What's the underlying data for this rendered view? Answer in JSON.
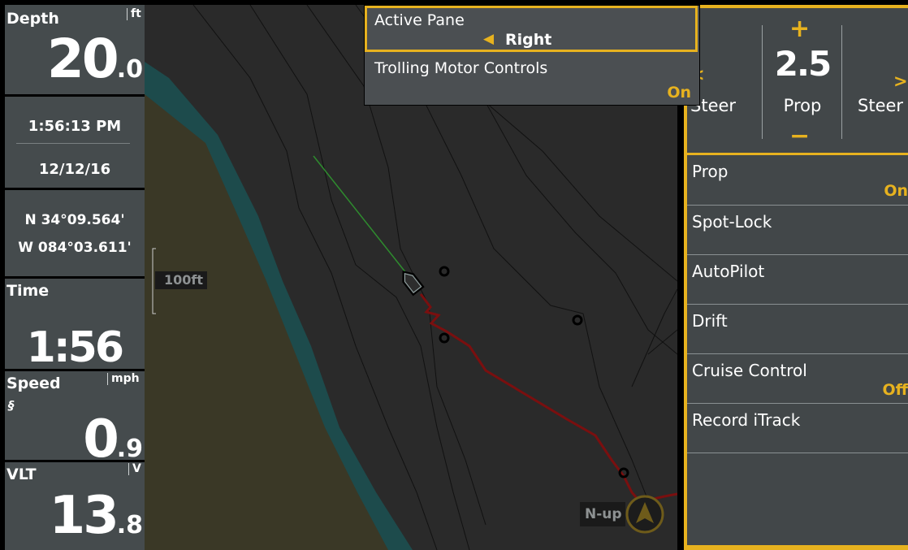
{
  "colors": {
    "accent": "#e7b21f",
    "panel": "#454b4d",
    "track": "#7a0f0f",
    "land": "#3b3a27",
    "shore": "#1b4a4a"
  },
  "databar": {
    "depth": {
      "label": "Depth",
      "unit": "ft",
      "value_int": "20",
      "value_dec": ".0"
    },
    "clock": "1:56:13 PM",
    "date": "12/12/16",
    "lat": "N 34°09.564'",
    "lon": "W 084°03.611'",
    "time": {
      "label": "Time",
      "value": "1:56"
    },
    "speed": {
      "label": "Speed",
      "unit": "mph",
      "value_int": "0",
      "value_dec": ".9"
    },
    "vlt": {
      "label": "VLT",
      "unit": "V",
      "value_int": "13",
      "value_dec": ".8"
    }
  },
  "map": {
    "range_label": "100ft",
    "orientation_label": "N-up",
    "icons": [
      "boat-icon",
      "waypoint-icon",
      "north-arrow-icon"
    ]
  },
  "popup": {
    "active_pane_label": "Active Pane",
    "active_pane_value": "Right",
    "trolling_label": "Trolling Motor Controls",
    "trolling_value": "On"
  },
  "right_pane": {
    "steer_left": "Steer",
    "prop_label": "Prop",
    "steer_right": "Steer",
    "speed_value": "2.5",
    "plus": "+",
    "minus": "−",
    "items": [
      {
        "label": "Prop",
        "value": "On"
      },
      {
        "label": "Spot-Lock",
        "value": ""
      },
      {
        "label": "AutoPilot",
        "value": ""
      },
      {
        "label": "Drift",
        "value": ""
      },
      {
        "label": "Cruise Control",
        "value": "Off"
      },
      {
        "label": "Record iTrack",
        "value": ""
      }
    ]
  }
}
